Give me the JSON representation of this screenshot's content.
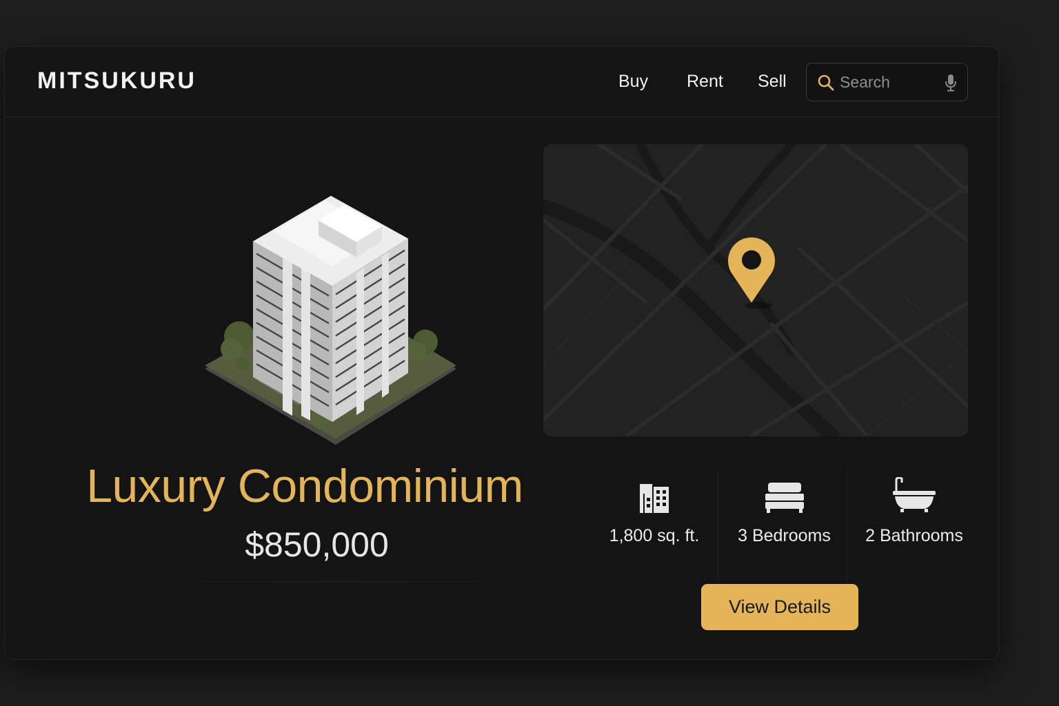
{
  "header": {
    "brand": "MITSUKURU",
    "nav": [
      "Buy",
      "Rent",
      "Sell"
    ],
    "search": {
      "placeholder": "Search",
      "icon": "search-icon",
      "mic_icon": "microphone-icon"
    }
  },
  "listing": {
    "title": "Luxury Condominium",
    "price": "$850,000",
    "image": "condominium-building-illustration",
    "map_marker": "map-pin-icon",
    "stats": [
      {
        "icon": "building-icon",
        "label": "1,800 sq. ft."
      },
      {
        "icon": "bed-icon",
        "label": "3 Bedrooms"
      },
      {
        "icon": "bathtub-icon",
        "label": "2 Bathrooms"
      }
    ],
    "cta": "View Details"
  },
  "colors": {
    "accent": "#e3b45a",
    "background": "#1e1e1e",
    "card": "#141414",
    "map": "#222222"
  }
}
